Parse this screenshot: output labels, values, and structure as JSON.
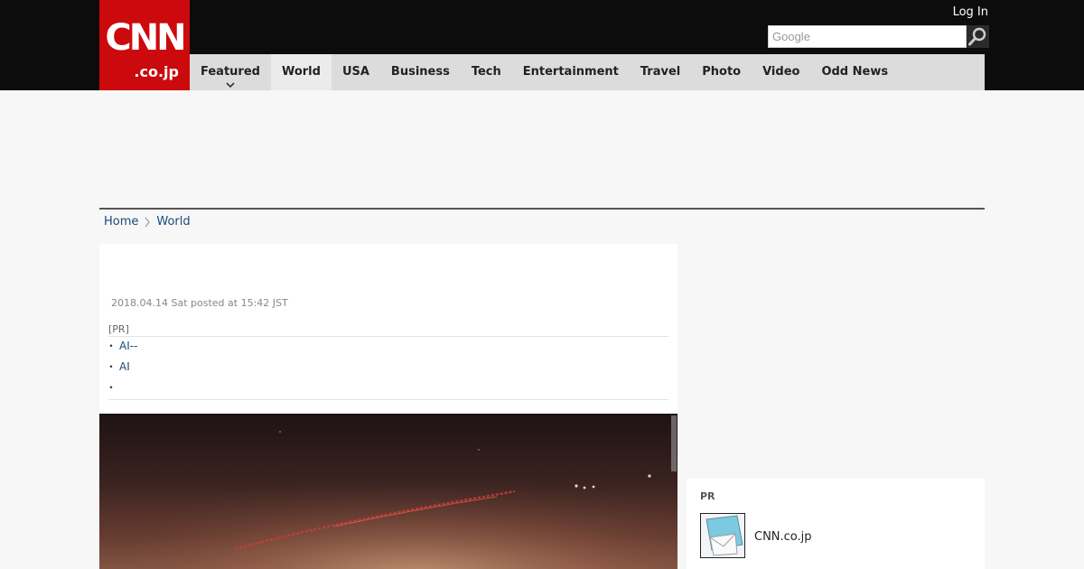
{
  "header": {
    "logo_main": "CNN",
    "logo_sub": ".co.jp",
    "login_label": "Log In",
    "search_placeholder": "Google"
  },
  "nav": {
    "items": [
      {
        "label": "Featured"
      },
      {
        "label": "World"
      },
      {
        "label": "USA"
      },
      {
        "label": "Business"
      },
      {
        "label": "Tech"
      },
      {
        "label": "Entertainment"
      },
      {
        "label": "Travel"
      },
      {
        "label": "Photo"
      },
      {
        "label": "Video"
      },
      {
        "label": "Odd News"
      }
    ],
    "active": "World"
  },
  "breadcrumb": {
    "home": "Home",
    "current": "World"
  },
  "article": {
    "dateline": "2018.04.14 Sat posted at 15:42 JST",
    "pr_title": "[PR]",
    "pr_links": [
      "AI--",
      "AI",
      ""
    ]
  },
  "sidebar": {
    "pr_label": "PR",
    "link_label": "CNN.co.jp"
  },
  "colors": {
    "brand_red": "#cc0a0d",
    "topbar": "#0c0c0c",
    "nav_bg": "#dcdcdc",
    "link": "#1a4a7a"
  },
  "icons": {
    "search": "magnifier-icon",
    "caret": "chevron-down-icon",
    "breadcrumb_sep": "chevron-right-icon",
    "side_thumb": "mail-icon"
  }
}
